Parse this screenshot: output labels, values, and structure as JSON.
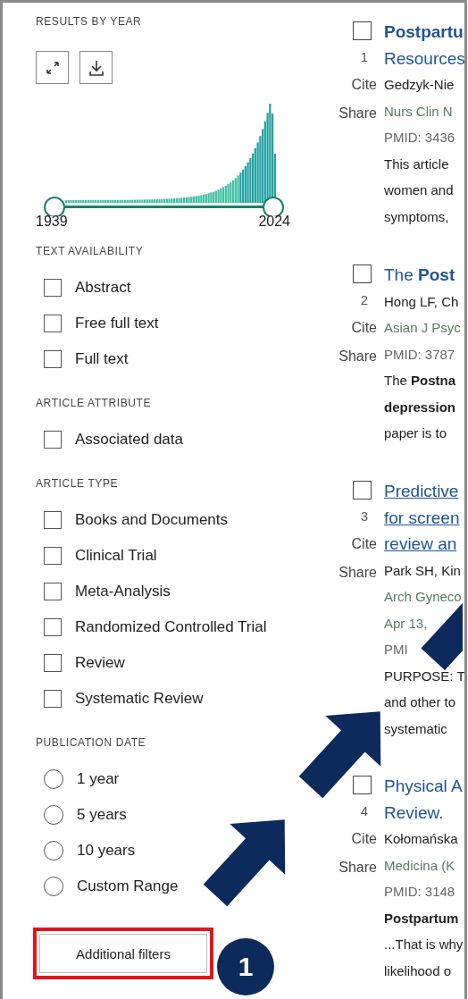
{
  "results_by_year": {
    "title": "RESULTS BY YEAR",
    "start_year": "1939",
    "end_year": "2024",
    "thumbs": [
      {
        "level": 0
      },
      {
        "level": 1
      }
    ]
  },
  "filter_groups": [
    {
      "title": "TEXT AVAILABILITY",
      "kind": "checkbox",
      "options": [
        {
          "label": "Abstract",
          "checked": false
        },
        {
          "label": "Free full text",
          "checked": false
        },
        {
          "label": "Full text",
          "checked": false
        }
      ]
    },
    {
      "title": "ARTICLE ATTRIBUTE",
      "kind": "checkbox",
      "options": [
        {
          "label": "Associated data",
          "checked": false
        }
      ]
    },
    {
      "title": "ARTICLE TYPE",
      "kind": "checkbox",
      "options": [
        {
          "label": "Books and Documents",
          "checked": false
        },
        {
          "label": "Clinical Trial",
          "checked": false
        },
        {
          "label": "Meta-Analysis",
          "checked": false
        },
        {
          "label": "Randomized Controlled Trial",
          "checked": false
        },
        {
          "label": "Review",
          "checked": false
        },
        {
          "label": "Systematic Review",
          "checked": false
        }
      ]
    },
    {
      "title": "PUBLICATION DATE",
      "kind": "radio",
      "options": [
        {
          "label": "1 year",
          "selected": false
        },
        {
          "label": "5 years",
          "selected": false
        },
        {
          "label": "10 years",
          "selected": false
        },
        {
          "label": "Custom Range",
          "selected": false
        }
      ]
    }
  ],
  "additional_filters": {
    "label": "Additional filters",
    "highlighted": true,
    "step": "1"
  },
  "results": [
    {
      "index": "1",
      "checked": false,
      "cite": "Cite",
      "share": "Share",
      "underlined": false,
      "title_lines": [
        "**Postpartu**",
        "Resources"
      ],
      "authors": "Gedzyk-Nie",
      "journal_lines": [
        "Nurs Clin N"
      ],
      "pmid": "PMID: 3436",
      "snippet_lines": [
        "This article",
        "women and",
        "symptoms,"
      ]
    },
    {
      "index": "2",
      "checked": false,
      "cite": "Cite",
      "share": "Share",
      "underlined": false,
      "title_lines": [
        "The **Post**"
      ],
      "authors": "Hong LF, Ch",
      "journal_lines": [
        "Asian J Psyc"
      ],
      "pmid": "PMID: 3787",
      "snippet_lines": [
        "The **Postna**",
        "**depression**",
        "paper is to"
      ]
    },
    {
      "index": "3",
      "checked": false,
      "cite": "Cite",
      "share": "Share",
      "underlined": true,
      "title_lines": [
        "Predictive",
        "for screen",
        "review an"
      ],
      "authors": "Park SH, Kin",
      "journal_lines": [
        "Arch Gyneco",
        "Apr 13,"
      ],
      "pmid": "PMI",
      "snippet_lines": [
        "PURPOSE: T",
        "and other to",
        "systematic"
      ]
    },
    {
      "index": "4",
      "checked": false,
      "cite": "Cite",
      "share": "Share",
      "underlined": false,
      "title_lines": [
        "Physical A",
        "Review."
      ],
      "authors": "Kołomańska",
      "journal_lines": [
        "Medicina (K"
      ],
      "pmid": "PMID: 3148",
      "snippet_lines": [
        "**Postpartum**",
        "...That is why",
        "likelihood o"
      ]
    }
  ]
}
